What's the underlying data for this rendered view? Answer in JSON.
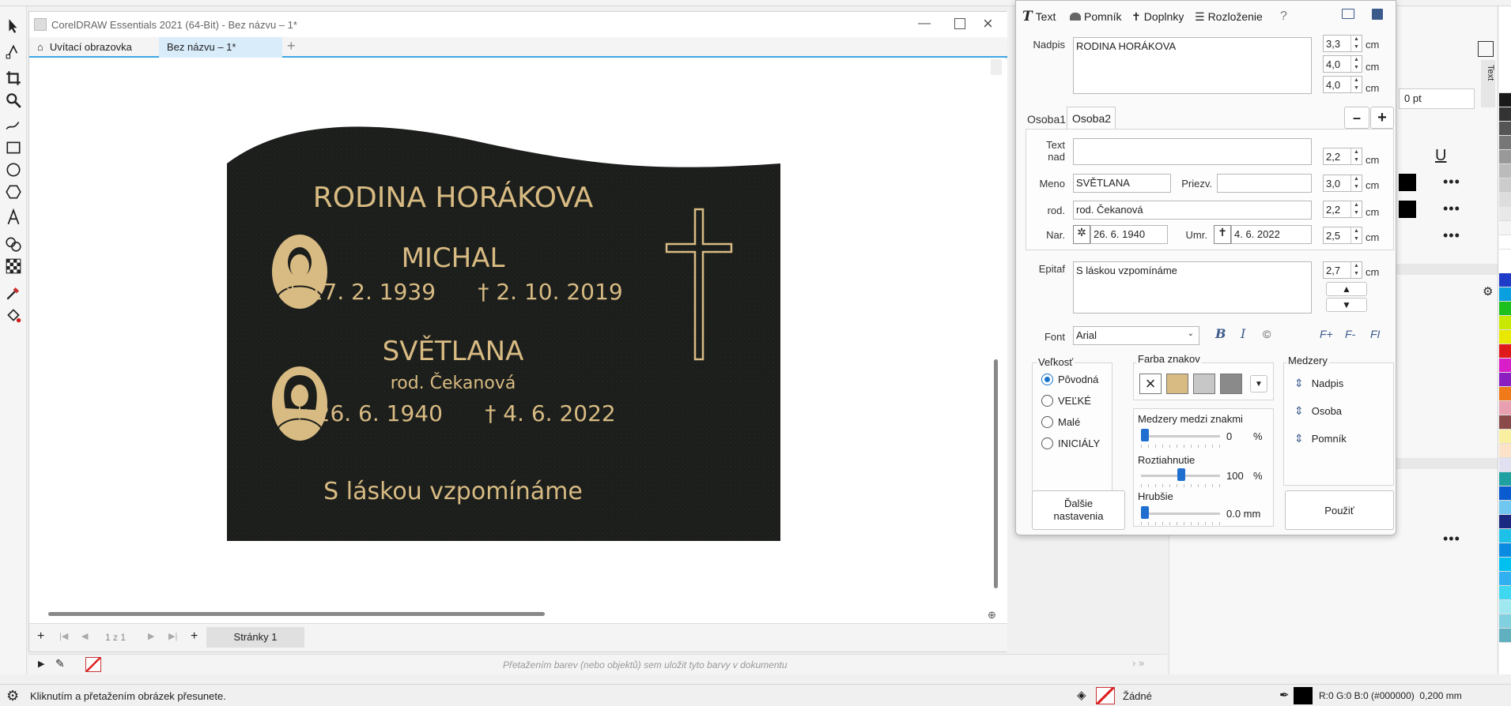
{
  "app": {
    "doc_title": "CorelDRAW Essentials 2021 (64-Bit) - Bez názvu – 1*",
    "tabs": [
      "Uvítací obrazovka",
      "Bez názvu – 1*"
    ]
  },
  "plaque": {
    "family": "RODINA HORÁKOVA",
    "person1": {
      "name": "MICHAL",
      "dates": "✶ 17. 2. 1939      † 2. 10. 2019"
    },
    "person2": {
      "name": "SVĚTLANA",
      "birth_name": "rod. Čekanová",
      "dates": "✶ 26. 6. 1940      † 4. 6. 2022"
    },
    "epitaph": "S láskou vzpomínáme"
  },
  "doc_bottom": {
    "page_count": "1 z 1",
    "page_tab": "Stránky 1"
  },
  "colorbar_hint": "Přetažením barev (nebo objektů) sem uložit tyto barvy v dokumentu",
  "dialog": {
    "tabs": [
      "Text",
      "Pomník",
      "Doplnky",
      "Rozloženie",
      "?"
    ],
    "nadpis_label": "Nadpis",
    "nadpis_value": "RODINA HORÁKOVA",
    "nadpis_sizes": [
      "3,3",
      "4,0",
      "4,0"
    ],
    "unit": "cm",
    "person_tabs": [
      "Osoba1",
      "Osoba2"
    ],
    "minus": "–",
    "plus": "+",
    "text_nad_label": "Text nad",
    "text_nad_value": "",
    "meno_label": "Meno",
    "meno_value": "SVĚTLANA",
    "priezv_label": "Priezv.",
    "priezv_value": "",
    "rod_label": "rod.",
    "rod_value": "rod. Čekanová",
    "nar_label": "Nar.",
    "nar_value": "26. 6. 1940",
    "umr_label": "Umr.",
    "umr_value": "4. 6. 2022",
    "person_sizes": [
      "2,2",
      "3,0",
      "2,2",
      "2,5"
    ],
    "epitaf_label": "Epitaf",
    "epitaf_value": "S láskou vzpomínáme",
    "epitaf_size": "2,7",
    "font_label": "Font",
    "font_value": "Arial",
    "velkost_title": "Veľkosť",
    "velkost_options": [
      "Pôvodná",
      "VEĽKÉ",
      "Malé",
      "INICIÁLY"
    ],
    "velkost_selected": "Pôvodná",
    "farba_title": "Farba znakov",
    "spacing_title": "Medzery medzi znakmi",
    "spacing_value": "0",
    "spacing_unit": "%",
    "stretch_title": "Roztiahnutie",
    "stretch_value": "100",
    "stretch_unit": "%",
    "thick_title": "Hrubšie",
    "thick_value": "0.0 mm",
    "medzery_title": "Medzery",
    "medzery_items": [
      "Nadpis",
      "Osoba",
      "Pomník"
    ],
    "dalsie_button": "Ďalšie nastavenia",
    "pouzit_button": "Použiť"
  },
  "docker": {
    "pt_value": "0 pt",
    "side_tab": "Text"
  },
  "status": {
    "hint": "Kliknutím a přetažením obrázek přesunete.",
    "fill": "Žádné",
    "outline": "R:0 G:0 B:0 (#000000)  0,200 mm"
  },
  "colors": {
    "plaque_bg": "#1c1e1c",
    "gold": "#d8bb82",
    "accent": "#3ba7e6"
  }
}
